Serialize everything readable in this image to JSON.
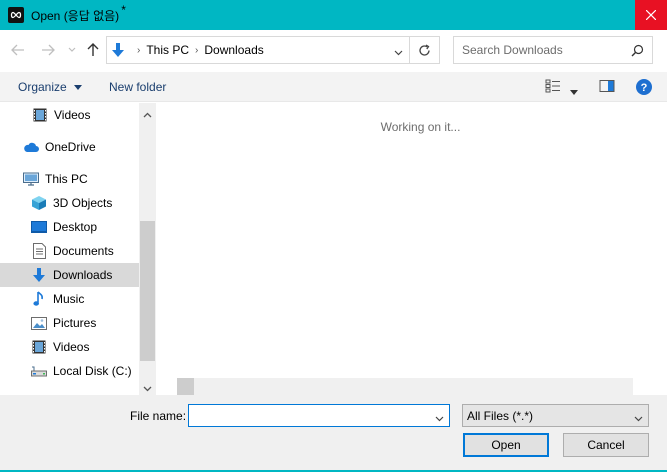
{
  "window": {
    "title": "Open (응답 없음)",
    "title_mark": "*",
    "accent": "#00b7c3",
    "close_color": "#e81123"
  },
  "nav": {
    "breadcrumbs": [
      "This PC",
      "Downloads"
    ],
    "search_placeholder": "Search Downloads"
  },
  "toolbar": {
    "organize_label": "Organize",
    "new_folder_label": "New folder"
  },
  "sidebar": {
    "items": [
      {
        "label": "Videos",
        "icon": "film-icon",
        "indent": 2
      },
      {
        "label": "OneDrive",
        "icon": "cloud-icon",
        "indent": 1
      },
      {
        "label": "This PC",
        "icon": "monitor-icon",
        "indent": 1
      },
      {
        "label": "3D Objects",
        "icon": "cube-icon",
        "indent": 2
      },
      {
        "label": "Desktop",
        "icon": "desktop-icon",
        "indent": 2
      },
      {
        "label": "Documents",
        "icon": "document-icon",
        "indent": 2
      },
      {
        "label": "Downloads",
        "icon": "download-arrow-icon",
        "indent": 2,
        "selected": true
      },
      {
        "label": "Music",
        "icon": "music-note-icon",
        "indent": 2
      },
      {
        "label": "Pictures",
        "icon": "picture-icon",
        "indent": 2
      },
      {
        "label": "Videos",
        "icon": "film-icon",
        "indent": 2
      },
      {
        "label": "Local Disk (C:)",
        "icon": "drive-icon",
        "indent": 2
      }
    ]
  },
  "content": {
    "status_text": "Working on it..."
  },
  "footer": {
    "file_name_label": "File name:",
    "file_name_value": "",
    "file_type_value": "All Files (*.*)",
    "open_label": "Open",
    "cancel_label": "Cancel"
  }
}
